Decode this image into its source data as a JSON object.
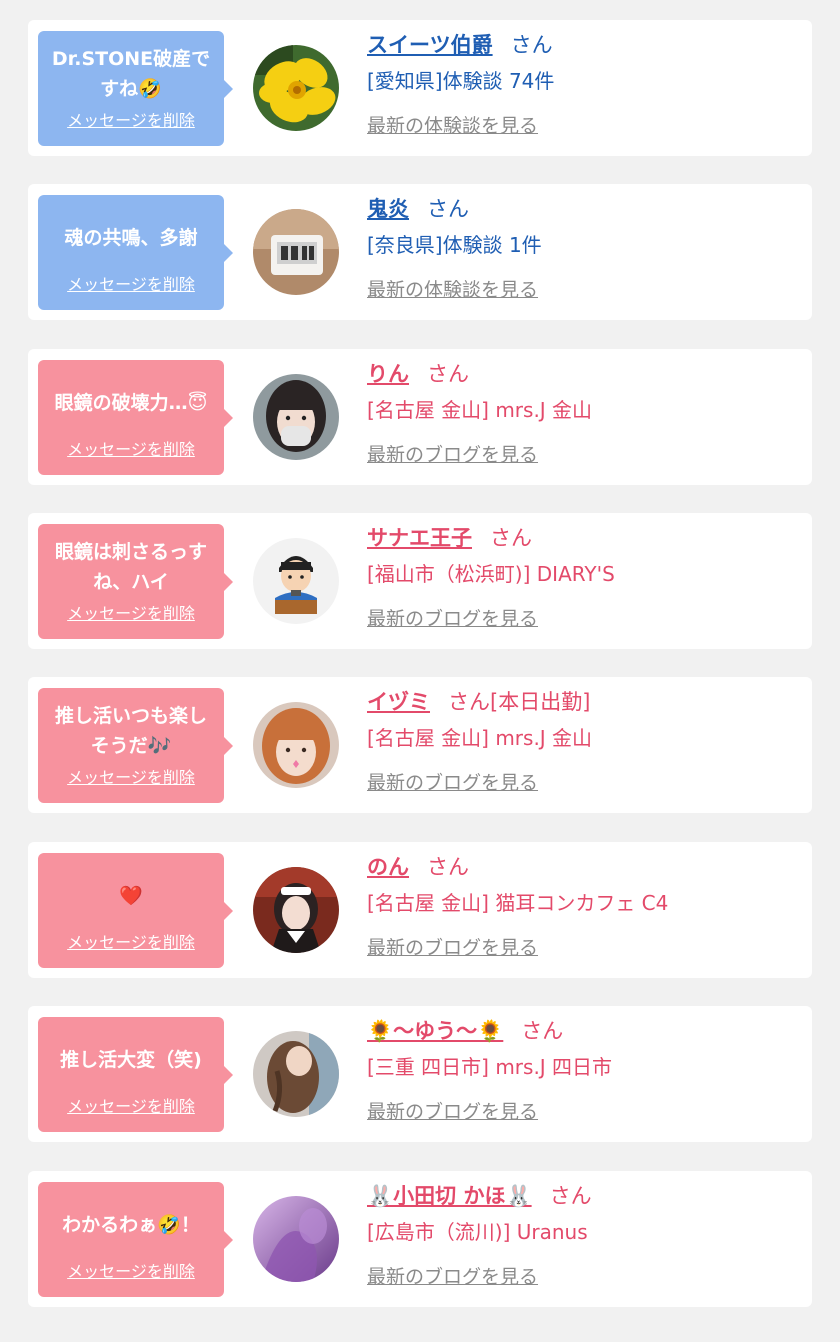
{
  "colors": {
    "blue_bubble": "#8db6f0",
    "pink_bubble": "#f7929e",
    "blue_text": "#1f5eb3",
    "pink_text": "#e34a6a",
    "link_gray": "#8a8a8a"
  },
  "messages": [
    {
      "bubble_color": "blue",
      "message": "Dr.STONE破産ですね🤣",
      "delete_label": "メッセージを削除",
      "name": "スイーツ伯爵",
      "suffix": "さん",
      "place": "[愛知県]体験談 74件",
      "latest_link": "最新の体験談を見る",
      "avatar": "yellow-flower-photo"
    },
    {
      "bubble_color": "blue",
      "message": "魂の共鳴、多謝",
      "delete_label": "メッセージを削除",
      "name": "鬼炎",
      "suffix": "さん",
      "place": "[奈良県]体験談 1件",
      "latest_link": "最新の体験談を見る",
      "avatar": "digital-clock-photo"
    },
    {
      "bubble_color": "pink",
      "message": "眼鏡の破壊力…😇",
      "delete_label": "メッセージを削除",
      "name": "りん",
      "suffix": "さん",
      "place": "[名古屋 金山] mrs.J 金山",
      "latest_link": "最新のブログを見る",
      "avatar": "girl-with-mask-photo"
    },
    {
      "bubble_color": "pink",
      "message": "眼鏡は刺さるっすね、ハイ",
      "delete_label": "メッセージを削除",
      "name": "サナエ王子",
      "suffix": "さん",
      "place": "[福山市（松浜町)] DIARY'S",
      "latest_link": "最新のブログを見る",
      "avatar": "speaker-illustration"
    },
    {
      "bubble_color": "pink",
      "message": "推し活いつも楽しそうだ🎶",
      "delete_label": "メッセージを削除",
      "name": "イヅミ",
      "suffix": "さん[本日出勤]",
      "place": "[名古屋 金山] mrs.J 金山",
      "latest_link": "最新のブログを見る",
      "avatar": "orange-hair-girl-photo"
    },
    {
      "bubble_color": "pink",
      "message": "❤️",
      "delete_label": "メッセージを削除",
      "name": "のん",
      "suffix": "さん",
      "place": "[名古屋 金山] 猫耳コンカフェ C4",
      "latest_link": "最新のブログを見る",
      "avatar": "maid-girl-photo"
    },
    {
      "bubble_color": "pink",
      "message": "推し活大変（笑)",
      "delete_label": "メッセージを削除",
      "name": "🌻～ゆう～🌻",
      "suffix": "さん",
      "place": "[三重 四日市] mrs.J 四日市",
      "latest_link": "最新のブログを見る",
      "avatar": "braided-hair-photo"
    },
    {
      "bubble_color": "pink",
      "message": "わかるわぁ🤣！",
      "delete_label": "メッセージを削除",
      "name": "🐰小田切 かほ🐰",
      "suffix": "さん",
      "place": "[広島市（流川)] Uranus",
      "latest_link": "最新のブログを見る",
      "avatar": "purple-hair-photo"
    }
  ]
}
